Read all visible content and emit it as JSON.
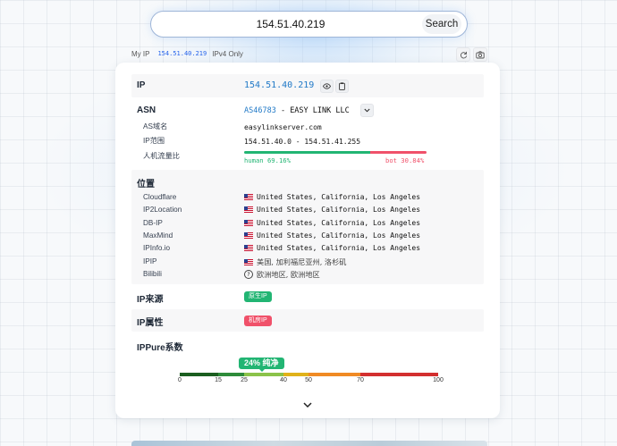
{
  "search": {
    "value": "154.51.40.219",
    "button_label": "Search"
  },
  "myip_bar": {
    "label": "My IP",
    "ip": "154.51.40.219",
    "mode": "IPv4 Only"
  },
  "card": {
    "ip": {
      "label": "IP",
      "value": "154.51.40.219"
    },
    "asn": {
      "label": "ASN",
      "number": "AS46783",
      "separator": " - ",
      "name": "EASY LINK LLC",
      "domain_label": "AS域名",
      "domain_value": "easylinkserver.com",
      "range_label": "IP范围",
      "range_value": "154.51.40.0 - 154.51.41.255",
      "ratio_label": "人机流量比",
      "human_text": "human 69.16%",
      "bot_text": "bot 30.84%",
      "human_percent": 69.16,
      "bot_percent": 30.84
    },
    "location": {
      "label": "位置",
      "rows": [
        {
          "source": "Cloudflare",
          "value": "United States, California, Los Angeles"
        },
        {
          "source": "IP2Location",
          "value": "United States, California, Los Angeles"
        },
        {
          "source": "DB-IP",
          "value": "United States, California, Los Angeles"
        },
        {
          "source": "MaxMind",
          "value": "United States, California, Los Angeles"
        },
        {
          "source": "IPInfo.io",
          "value": "United States, California, Los Angeles"
        },
        {
          "source": "IPIP",
          "value": "美国, 加利福尼亚州, 洛杉矶"
        },
        {
          "source": "Bilibili",
          "value": "欧洲地区, 欧洲地区"
        }
      ]
    },
    "source": {
      "label": "IP来源",
      "badge": "原生IP"
    },
    "attribute": {
      "label": "IP属性",
      "badge": "机房IP"
    },
    "purity": {
      "label": "IPPure系数",
      "score_text": "24% 纯净",
      "score": 24,
      "ticks": [
        "0",
        "15",
        "25",
        "40",
        "50",
        "70",
        "100"
      ]
    }
  },
  "colors": {
    "link": "#2079c7",
    "human": "#22b573",
    "bot": "#f0516a",
    "badge_native": "#22b573",
    "badge_datacenter": "#f0516a"
  },
  "icons": [
    "eye-icon",
    "copy-icon",
    "chevron-down-icon",
    "refresh-icon",
    "camera-icon",
    "flag-us-icon",
    "question-icon"
  ]
}
